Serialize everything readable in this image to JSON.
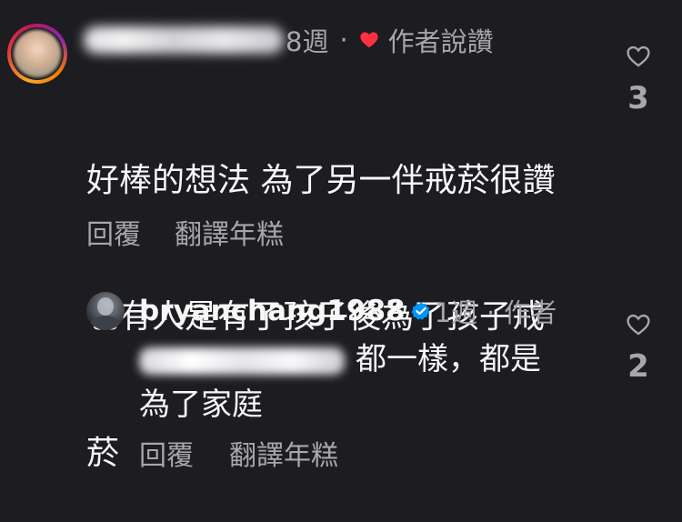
{
  "comment": {
    "timestamp": "8週",
    "separator": "·",
    "liked_by_author_label": "作者說讚",
    "lines": [
      "好棒的想法 為了另一伴戒菸很讚",
      "也有人是有了孩子後為了孩子戒",
      "菸"
    ],
    "reply_label": "回覆",
    "translate_label": "翻譯年糕",
    "like_count": "3"
  },
  "reply": {
    "username": "bryanchang1988",
    "timestamp": "1週",
    "separator": "·",
    "author_label": "作者",
    "text_line1": "都一樣，都是",
    "text_line2": "為了家庭",
    "reply_label": "回覆",
    "translate_label": "翻譯年糕",
    "like_count": "2"
  },
  "colors": {
    "background": "#1c1c21",
    "text_primary": "#f7f7f7",
    "text_secondary": "#a6a6ab",
    "heart_liked": "#ff3040",
    "verified_badge": "#0095f6"
  }
}
